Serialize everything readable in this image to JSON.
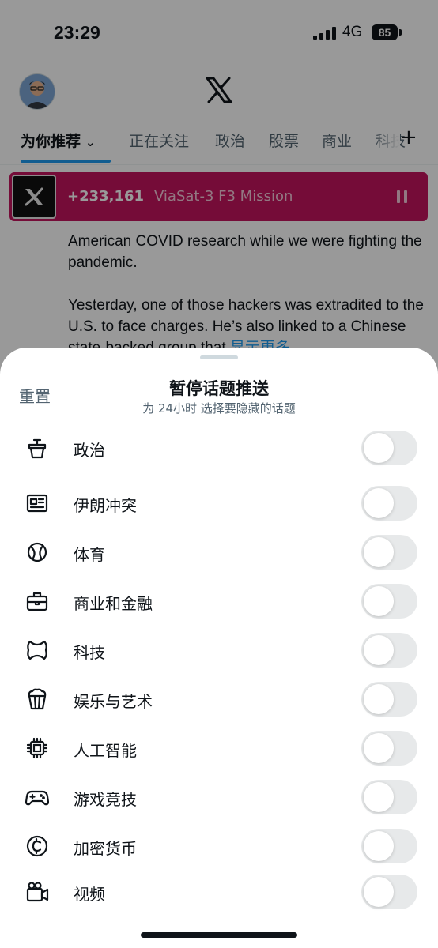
{
  "status_bar": {
    "time": "23:29",
    "network": "4G",
    "battery": "85"
  },
  "tabs": [
    {
      "label": "为你推荐"
    },
    {
      "label": "正在关注"
    },
    {
      "label": "政治"
    },
    {
      "label": "股票"
    },
    {
      "label": "商业"
    },
    {
      "label": "科技"
    }
  ],
  "live_banner": {
    "count": "+233,161",
    "title": "ViaSat-3 F3 Mission"
  },
  "tweet": {
    "paragraph1": "American COVID research while we were fighting the pandemic.",
    "paragraph2": "Yesterday, one of those hackers was extradited to the U.S. to face charges. He’s also linked to a Chinese state-backed group that",
    "show_more": "显示更多"
  },
  "sheet": {
    "reset_label": "重置",
    "title": "暂停话题推送",
    "subtitle": "为 24小时 选择要隐藏的话题",
    "topics": [
      {
        "label": "政治",
        "icon": "podium-icon",
        "enabled": false
      },
      {
        "label": "伊朗冲突",
        "icon": "news-icon",
        "enabled": false
      },
      {
        "label": "体育",
        "icon": "ball-icon",
        "enabled": false
      },
      {
        "label": "商业和金融",
        "icon": "briefcase-icon",
        "enabled": false
      },
      {
        "label": "科技",
        "icon": "tech-icon",
        "enabled": false
      },
      {
        "label": "娱乐与艺术",
        "icon": "popcorn-icon",
        "enabled": false
      },
      {
        "label": "人工智能",
        "icon": "chip-icon",
        "enabled": false
      },
      {
        "label": "游戏竞技",
        "icon": "gamepad-icon",
        "enabled": false
      },
      {
        "label": "加密货币",
        "icon": "crypto-icon",
        "enabled": false
      },
      {
        "label": "视频",
        "icon": "video-camera-icon",
        "enabled": false
      }
    ]
  }
}
